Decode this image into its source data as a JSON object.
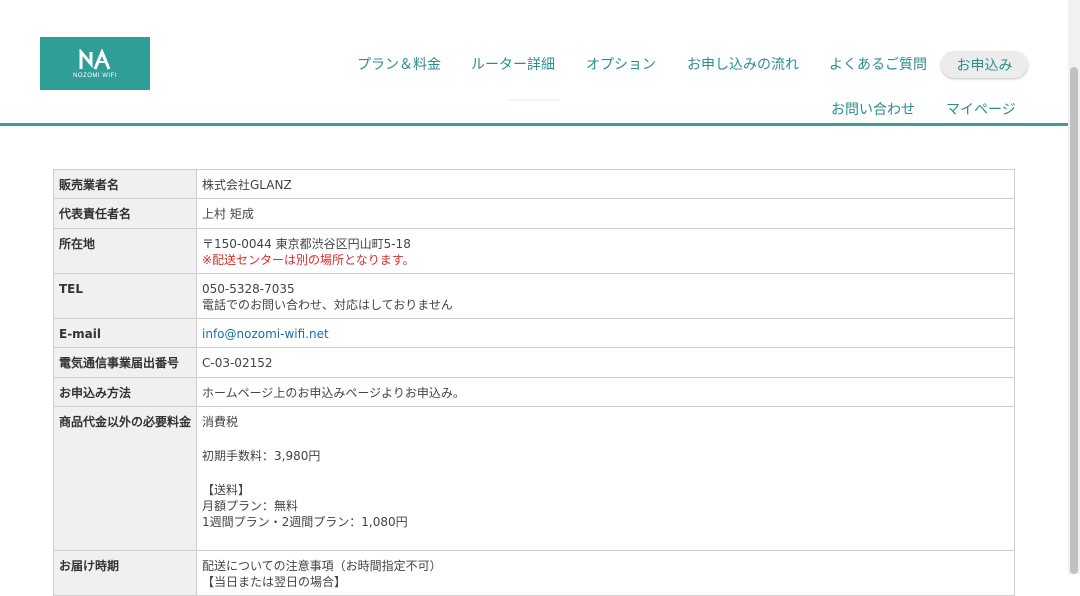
{
  "logo": {
    "text": "NOZOMI WIFI"
  },
  "nav": {
    "items": [
      "プラン＆料金",
      "ルーター詳細",
      "オプション",
      "お申し込みの流れ",
      "よくあるご質問"
    ],
    "apply": "お申込み",
    "contact": "お問い合わせ",
    "mypage": "マイページ"
  },
  "table": {
    "seller_label": "販売業者名",
    "seller_value": "株式会社GLANZ",
    "rep_label": "代表責任者名",
    "rep_value": "上村 矩成",
    "address_label": "所在地",
    "address_value": "〒150-0044 東京都渋谷区円山町5-18",
    "address_note": "※配送センターは別の場所となります。",
    "tel_label": "TEL",
    "tel_value": "050-5328-7035",
    "tel_note": "電話でのお問い合わせ、対応はしておりません",
    "email_label": "E-mail",
    "email_value": "info@nozomi-wifi.net",
    "telecom_label": "電気通信事業届出番号",
    "telecom_value": "C-03-02152",
    "apply_method_label": "お申込み方法",
    "apply_method_value": "ホームページ上のお申込みページよりお申込み。",
    "fees_label": "商品代金以外の必要料金",
    "fees_tax": "消費税",
    "fees_initial": "初期手数料：3,980円",
    "fees_shipping_head": "【送料】",
    "fees_monthly": "月額プラン：無料",
    "fees_weekly": "1週間プラン・2週間プラン：1,080円",
    "delivery_label": "お届け時期",
    "delivery_value": "配送についての注意事項（お時間指定不可）",
    "delivery_next": "【当日または翌日の場合】"
  },
  "colors": {
    "brand": "#2f9e97",
    "nav_text": "#2a8f8c",
    "note_red": "#d6312c",
    "link": "#1a6fae"
  }
}
